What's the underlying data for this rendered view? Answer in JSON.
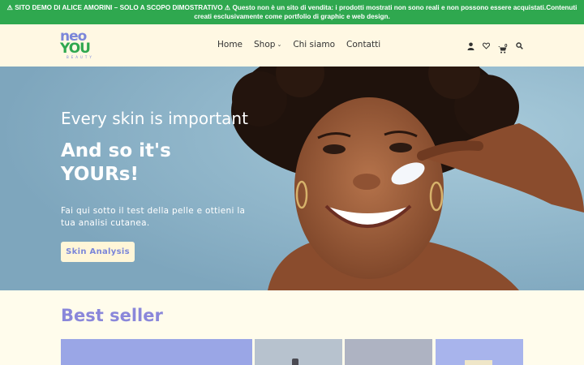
{
  "notice": {
    "text": "⚠ SITO DEMO DI ALICE AMORINI – SOLO A SCOPO DIMOSTRATIVO ⚠ Questo non è un sito di vendita: i prodotti mostrati non sono reali e non possono essere acquistati.Contenuti creati esclusivamente come portfolio di graphic e web design."
  },
  "brand": {
    "line1": "neo",
    "line2": "YOU",
    "tagline": "BEAUTY"
  },
  "nav": {
    "items": [
      {
        "label": "Home"
      },
      {
        "label": "Shop",
        "has_dropdown": true
      },
      {
        "label": "Chi siamo"
      },
      {
        "label": "Contatti"
      }
    ]
  },
  "header_icons": [
    "user-icon",
    "heart-icon",
    "cart-icon",
    "search-icon"
  ],
  "cart": {
    "count": "0"
  },
  "hero": {
    "headline": "Every skin is important",
    "subheadline": "And so it's YOURs!",
    "body": "Fai qui sotto il test della pelle e ottieni la tua analisi cutanea.",
    "cta_label": "Skin Analysis"
  },
  "best_seller": {
    "title": "Best seller"
  },
  "colors": {
    "banner_green": "#2fa84f",
    "brand_purple": "#7b86d9",
    "header_bg": "#fff8e3",
    "page_bg": "#fffcec",
    "cta_bg": "#fff6d8"
  }
}
